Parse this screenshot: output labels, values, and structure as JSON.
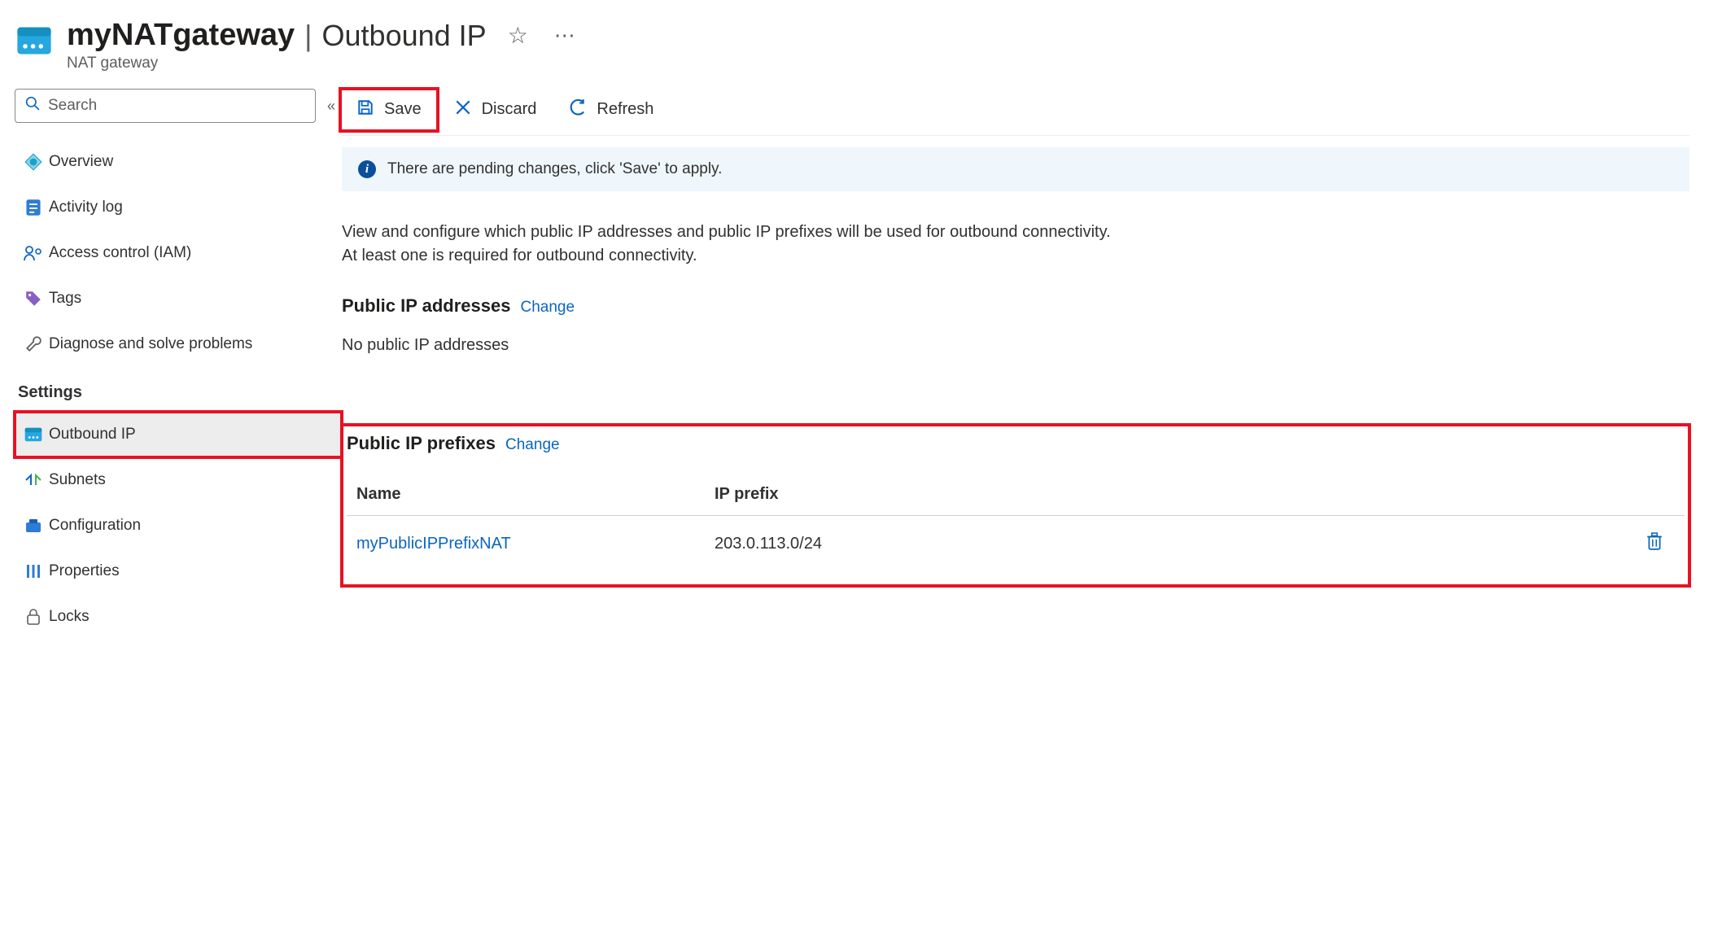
{
  "header": {
    "resource_name": "myNATgateway",
    "page_title": "Outbound IP",
    "resource_type": "NAT gateway"
  },
  "sidebar": {
    "search_placeholder": "Search",
    "items": [
      {
        "label": "Overview",
        "icon": "globe"
      },
      {
        "label": "Activity log",
        "icon": "log"
      },
      {
        "label": "Access control (IAM)",
        "icon": "iam"
      },
      {
        "label": "Tags",
        "icon": "tag"
      },
      {
        "label": "Diagnose and solve problems",
        "icon": "wrench"
      }
    ],
    "settings_header": "Settings",
    "settings_items": [
      {
        "label": "Outbound IP",
        "icon": "nat",
        "selected": true
      },
      {
        "label": "Subnets",
        "icon": "subnets"
      },
      {
        "label": "Configuration",
        "icon": "config"
      },
      {
        "label": "Properties",
        "icon": "props"
      },
      {
        "label": "Locks",
        "icon": "lock"
      }
    ]
  },
  "toolbar": {
    "save_label": "Save",
    "discard_label": "Discard",
    "refresh_label": "Refresh"
  },
  "banner": {
    "text": "There are pending changes, click 'Save' to apply."
  },
  "main": {
    "description": "View and configure which public IP addresses and public IP prefixes will be used for outbound connectivity. At least one is required for outbound connectivity.",
    "public_ip_addresses": {
      "title": "Public IP addresses",
      "change_label": "Change",
      "empty_text": "No public IP addresses"
    },
    "public_ip_prefixes": {
      "title": "Public IP prefixes",
      "change_label": "Change",
      "columns": {
        "name": "Name",
        "prefix": "IP prefix"
      },
      "rows": [
        {
          "name": "myPublicIPPrefixNAT",
          "prefix": "203.0.113.0/24"
        }
      ]
    }
  },
  "colors": {
    "link": "#0b65c2",
    "accent_red": "#e81123",
    "banner_bg": "#eff6fc"
  }
}
